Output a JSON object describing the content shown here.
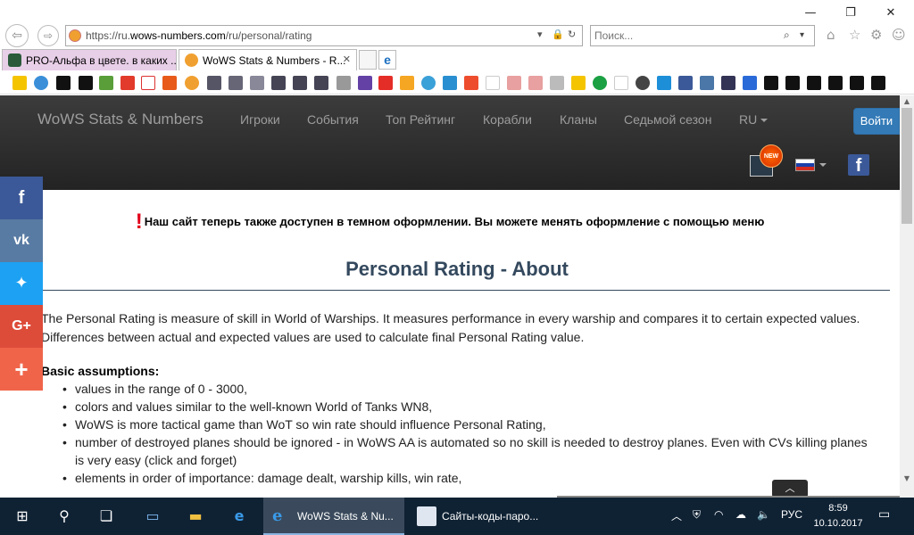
{
  "browser": {
    "url_prefix": "https://ru.",
    "url_domain": "wows-numbers.com",
    "url_path": "/ru/personal/rating",
    "search_placeholder": "Поиск...",
    "tabs": [
      {
        "title": "PRO-Альфа в цвете. в каких ...",
        "active": false
      },
      {
        "title": "WoWS Stats & Numbers - R...",
        "active": true
      }
    ]
  },
  "site": {
    "brand": "WoWS Stats & Numbers",
    "menu": [
      "Игроки",
      "События",
      "Топ Рейтинг",
      "Корабли",
      "Кланы",
      "Седьмой сезон"
    ],
    "language": "RU",
    "login_label": "Войти",
    "new_badge": "NEW",
    "facebook_glyph": "f"
  },
  "content": {
    "notice_mark": "!",
    "notice": "Наш сайт теперь также доступен в темном оформлении. Вы можете менять оформление с помощью меню",
    "title": "Personal Rating - About",
    "paragraph": "The Personal Rating is measure of skill in World of Warships. It measures performance in every warship and compares it to certain expected values. Differences between actual and expected values are used to calculate final Personal Rating value.",
    "subheading": "Basic assumptions:",
    "assumptions": [
      "values in the range of 0 - 3000,",
      "colors and values similar to the well-known World of Tanks WN8,",
      "WoWS is more tactical game than WoT so win rate should influence Personal Rating,",
      "number of destroyed planes should be ignored - in WoWS AA is automated so no skill is needed to destroy planes. Even with CVs killing planes is very easy (click and forget)",
      "elements in order of importance: damage dealt, warship kills, win rate,"
    ]
  },
  "share": [
    {
      "icon": "facebook-icon",
      "glyph": "f",
      "color": "#3b5998"
    },
    {
      "icon": "vk-icon",
      "glyph": "vk",
      "color": "#587ba3"
    },
    {
      "icon": "twitter-icon",
      "glyph": "🐦",
      "color": "#1da1f2"
    },
    {
      "icon": "google-plus-icon",
      "glyph": "G+",
      "color": "#dd4b39"
    },
    {
      "icon": "more-share-icon",
      "glyph": "+",
      "color": "#f0654a"
    }
  ],
  "taskbar": {
    "tasks": [
      {
        "title": "WoWS Stats & Nu...",
        "active": true
      },
      {
        "title": "Сайты-коды-паро...",
        "active": false
      }
    ],
    "language": "РУС",
    "time": "8:59",
    "date": "10.10.2017"
  }
}
